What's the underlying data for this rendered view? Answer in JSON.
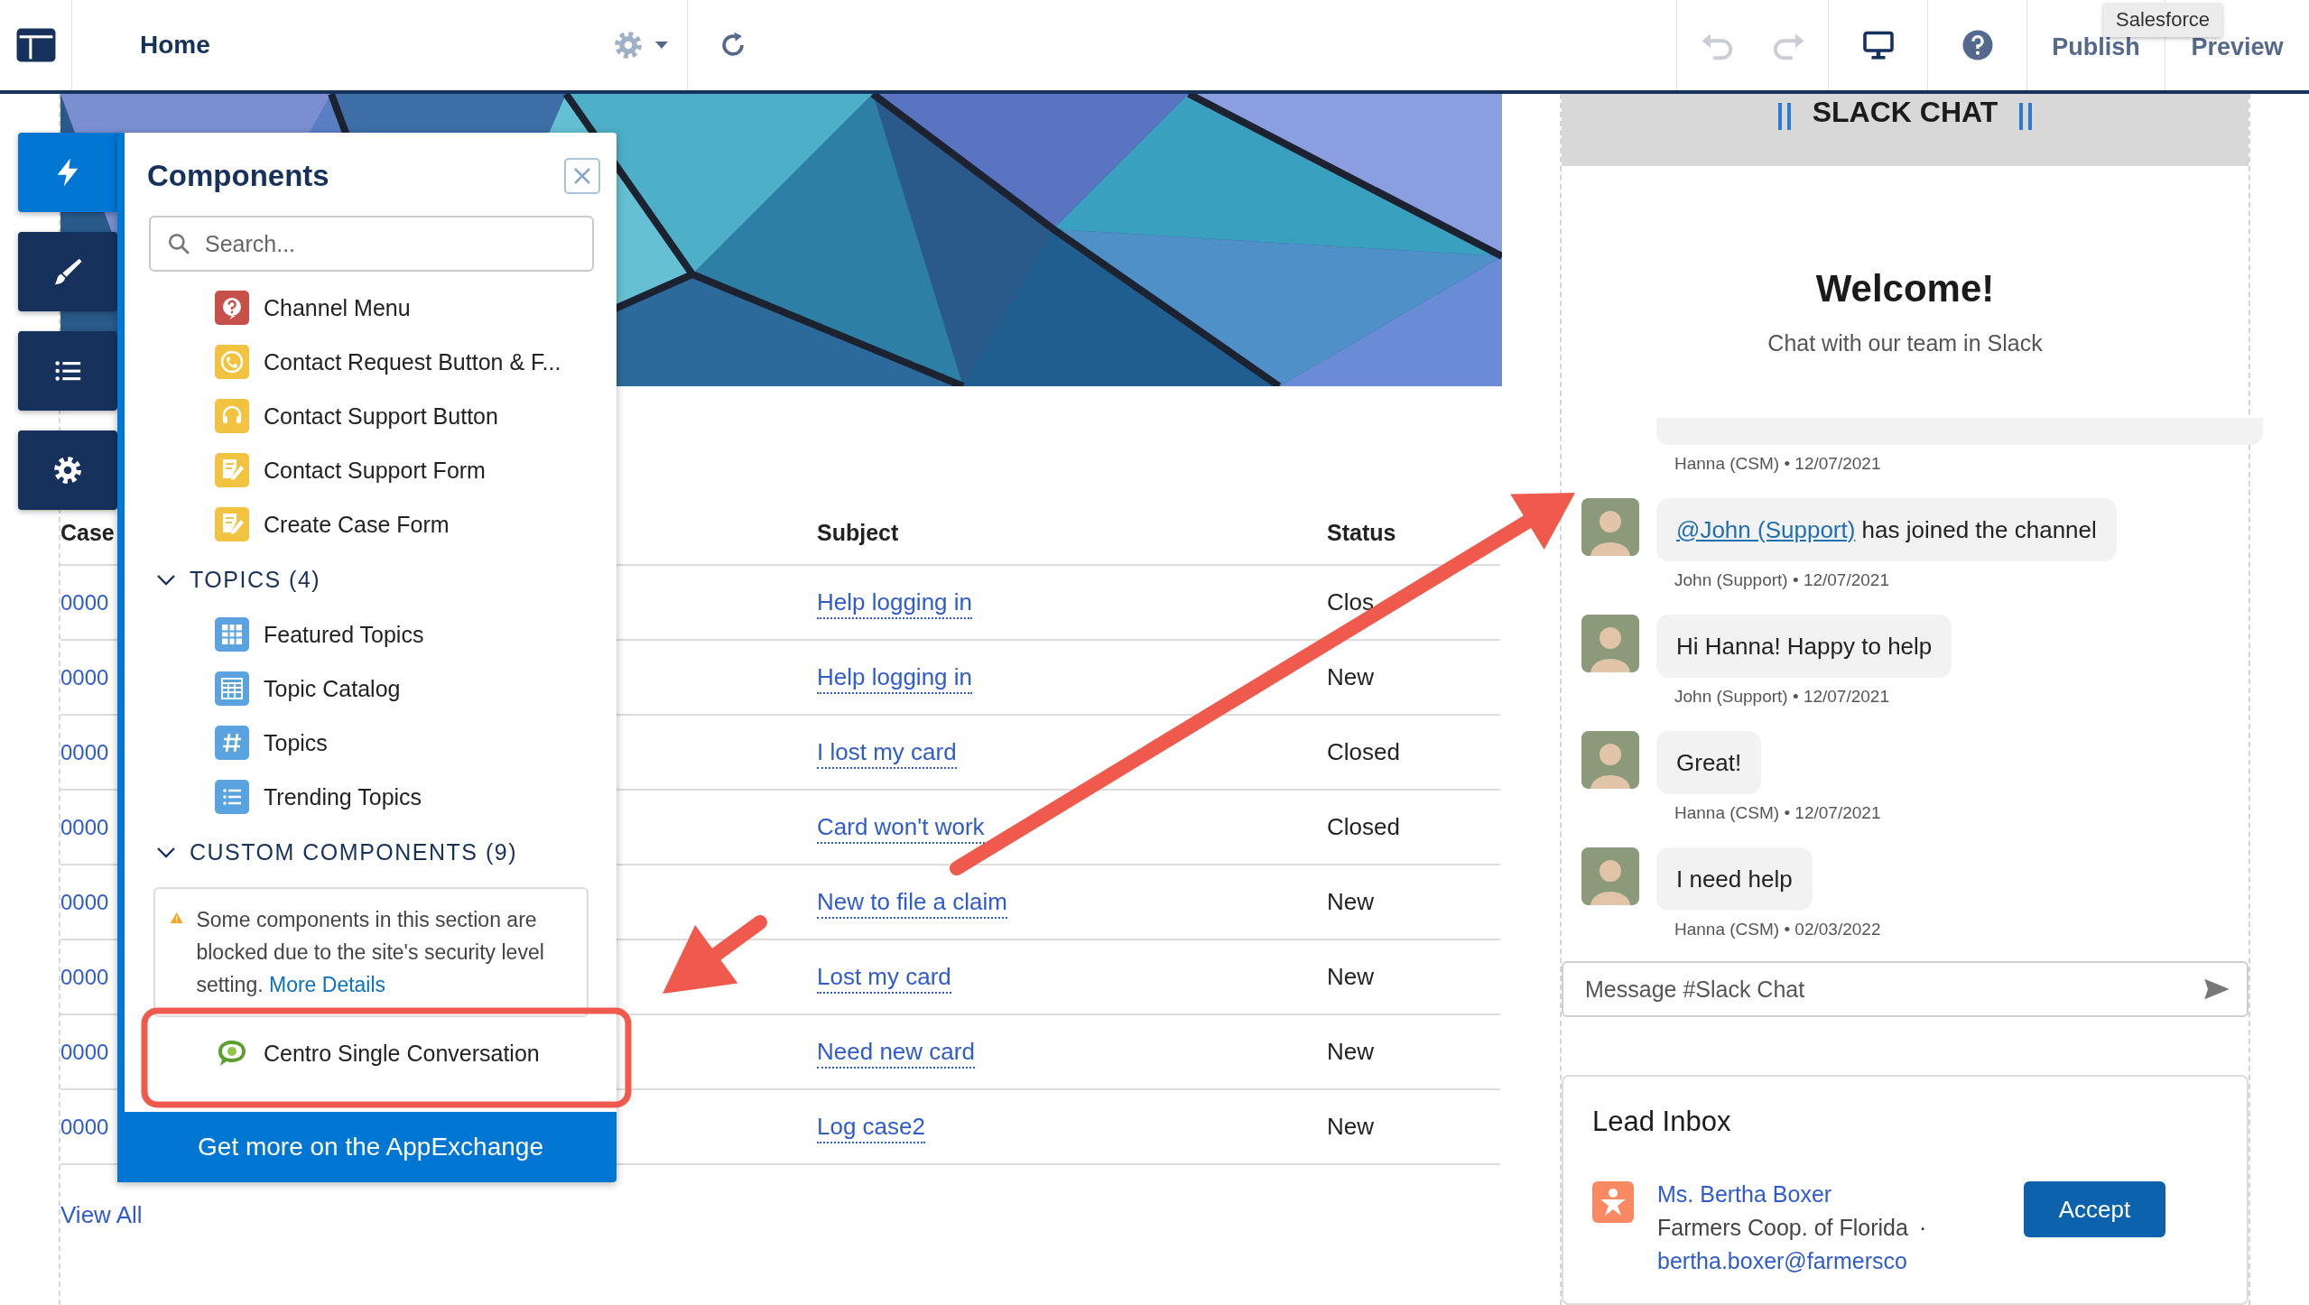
{
  "top_bar": {
    "title": "Home",
    "actions": [
      {
        "kind": "undo",
        "disabled": true
      },
      {
        "kind": "redo",
        "disabled": true
      }
    ],
    "publish": "Publish",
    "preview": "Preview",
    "tooltip": "Salesforce"
  },
  "left_toolbar": [
    {
      "kind": "bolt",
      "selected": true
    },
    {
      "kind": "brush",
      "selected": false
    },
    {
      "kind": "list",
      "selected": false
    },
    {
      "kind": "gear",
      "selected": false
    }
  ],
  "components_panel": {
    "title": "Components",
    "search": {
      "placeholder": "Search..."
    },
    "items": [
      {
        "label": "Channel Menu",
        "kind": "question"
      },
      {
        "label": "Contact Request Button & F...",
        "kind": "callback"
      },
      {
        "label": "Contact Support Button",
        "kind": "headset"
      },
      {
        "label": "Contact Support Form",
        "kind": "form"
      },
      {
        "label": "Create Case Form",
        "kind": "form"
      }
    ],
    "sections": [
      {
        "title": "TOPICS (4)",
        "expanded": true,
        "items": [
          {
            "label": "Featured Topics",
            "kind": "grid"
          },
          {
            "label": "Topic Catalog",
            "kind": "table"
          },
          {
            "label": "Topics",
            "kind": "hash"
          },
          {
            "label": "Trending Topics",
            "kind": "list"
          }
        ]
      },
      {
        "title": "CUSTOM COMPONENTS (9)",
        "expanded": true,
        "warning": {
          "text": "Some components in this section are blocked due to the site's security level setting.",
          "link": "More Details"
        },
        "items": [
          {
            "label": "Centro Single Conversation",
            "kind": "chat"
          }
        ]
      }
    ],
    "footer_button": "Get more on the AppExchange"
  },
  "cases_table": {
    "columns": [
      "Case",
      "Subject",
      "Status"
    ],
    "rows": [
      {
        "case": "0000",
        "subject": "Help logging in",
        "status": "Clos"
      },
      {
        "case": "0000",
        "subject": "Help logging in",
        "status": "New"
      },
      {
        "case": "0000",
        "subject": "I lost my card",
        "status": "Closed"
      },
      {
        "case": "0000",
        "subject": "Card won't work",
        "status": "Closed"
      },
      {
        "case": "0000",
        "subject": "New to file a claim",
        "status": "New"
      },
      {
        "case": "0000",
        "subject": "Lost my card",
        "status": "New"
      },
      {
        "case": "0000",
        "subject": "Need new card",
        "status": "New"
      },
      {
        "case": "0000",
        "subject": "Log case2",
        "status": "New"
      }
    ]
  },
  "view_all": "View All",
  "slack_chat": {
    "header": "SLACK CHAT",
    "title": "Welcome!",
    "subtitle": "Chat with our team in Slack",
    "messages": [
      {
        "kind": "cut",
        "meta": "Hanna (CSM) • 12/07/2021"
      },
      {
        "kind": "message",
        "mention": "@John (Support)",
        "text": "has joined the channel",
        "meta": "John (Support) • 12/07/2021"
      },
      {
        "kind": "message",
        "text": "Hi Hanna! Happy to help",
        "meta": "John (Support) • 12/07/2021"
      },
      {
        "kind": "message",
        "text": "Great!",
        "meta": "Hanna (CSM) • 12/07/2021"
      },
      {
        "kind": "message",
        "text": "I need help",
        "meta": "Hanna (CSM) • 02/03/2022"
      }
    ],
    "input": {
      "placeholder": "Message #Slack Chat"
    }
  },
  "lead_inbox": {
    "title": "Lead Inbox",
    "leads": [
      {
        "name": "Ms. Bertha Boxer",
        "company": "Farmers Coop. of Florida",
        "separator": "·",
        "email": "bertha.boxer@farmersco",
        "button": "Accept"
      }
    ]
  },
  "annotations": [
    {
      "kind": "arrow"
    },
    {
      "kind": "arrow"
    },
    {
      "kind": "frame"
    }
  ]
}
